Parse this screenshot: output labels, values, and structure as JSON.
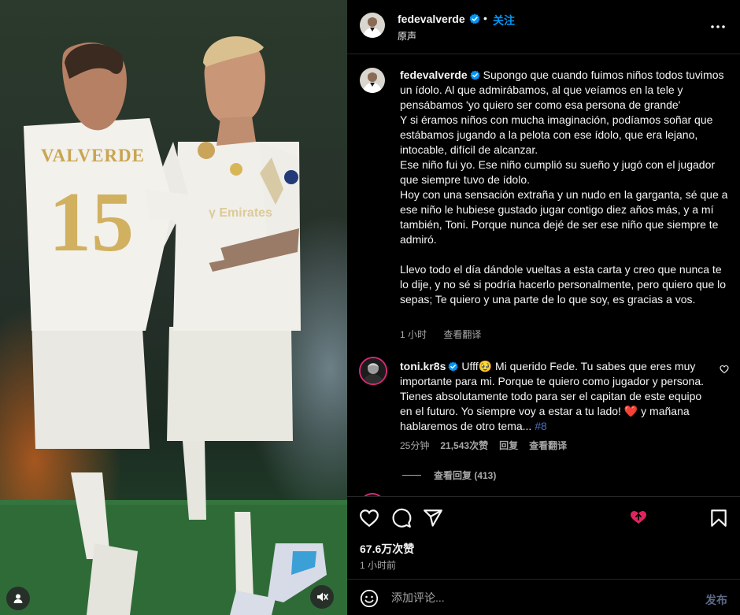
{
  "post": {
    "username": "fedevalverde",
    "verified": true,
    "separator": "•",
    "follow_label": "关注",
    "audio_label": "原声"
  },
  "media": {
    "jersey_name": "VALVERDE",
    "jersey_number": "15",
    "icons": [
      "user-tag-icon",
      "mute-icon"
    ]
  },
  "caption": {
    "username": "fedevalverde",
    "paragraph_1": "Supongo que cuando fuimos niños todos tuvimos un ídolo. Al que admirábamos, al que veíamos en la tele y pensábamos 'yo quiero ser como esa persona de grande'",
    "paragraph_2": "Y si éramos niños con mucha imaginación, podíamos soñar que estábamos jugando a la pelota con ese ídolo, que era lejano, intocable, difícil de alcanzar.",
    "paragraph_3": "Ese niño fui yo. Ese niño cumplió su sueño y jugó con el jugador que siempre tuvo de ídolo.",
    "paragraph_4": "Hoy con una sensación extraña y un nudo en la garganta, sé que a ese niño le hubiese gustado jugar contigo diez años más, y a mí también, Toni. Porque nunca dejé de ser ese niño que siempre te admiró.",
    "paragraph_5": "Llevo todo el día dándole vueltas a esta carta y creo que nunca te lo dije, y no sé si podría hacerlo personalmente, pero quiero que lo sepas; Te quiero y una parte de lo que soy, es gracias a vos.",
    "time": "1 小时",
    "see_translation": "查看翻译"
  },
  "comment": {
    "username": "toni.kr8s",
    "verified": true,
    "text": "Ufff🥹 Mi querido Fede. Tu sabes que eres muy importante para mi. Porque te quiero como jugador y persona. Tienes absolutamente todo para ser el capitan de este equipo en el futuro. Yo siempre voy a estar a tu lado!",
    "heart_emoji": "❤️",
    "text_after_heart": "y mañana hablaremos de otro tema...",
    "hashtag": "#8",
    "time": "25分钟",
    "likes": "21,543次赞",
    "reply_label": "回复",
    "see_translation": "查看翻译",
    "view_replies": "查看回复 (413)"
  },
  "actions": {
    "likes_count": "67.6万次赞",
    "time": "1 小时前",
    "icons": [
      "heart-icon",
      "comment-icon",
      "share-icon",
      "bookmark-icon"
    ]
  },
  "add_comment": {
    "placeholder": "添加评论...",
    "post_label": "发布"
  },
  "colors": {
    "accent": "#0095f6",
    "verified": "#0095f6",
    "hashtag": "#4a6fbf",
    "muted_text": "#a8a8a8",
    "post_disabled": "#5c6b8a",
    "heart_red": "#e0245e"
  }
}
